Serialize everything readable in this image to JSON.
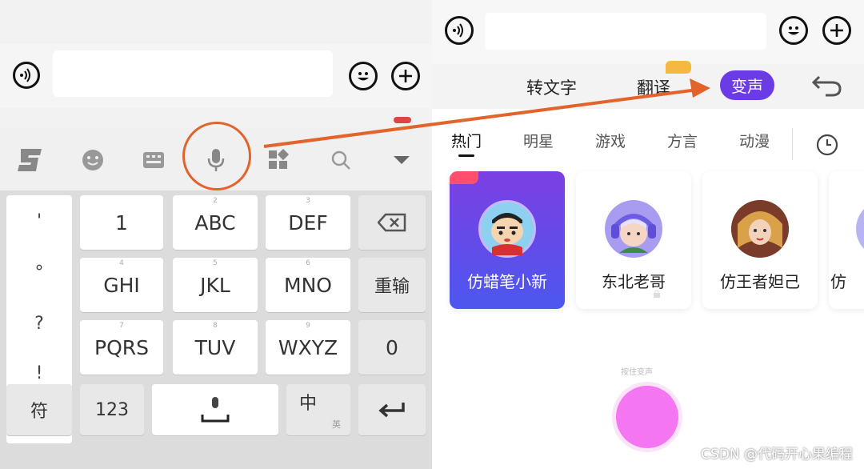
{
  "left": {
    "keyboard": {
      "punctuation": [
        "'",
        "°",
        "?",
        "!"
      ],
      "row1": [
        "1",
        "ABC",
        "DEF"
      ],
      "row1_mini": [
        "",
        "2",
        "3"
      ],
      "row2": [
        "GHI",
        "JKL",
        "MNO"
      ],
      "row2_mini": [
        "4",
        "5",
        "6"
      ],
      "row3": [
        "PQRS",
        "TUV",
        "WXYZ"
      ],
      "row3_mini": [
        "7",
        "8",
        "9"
      ],
      "reinput_label": "重输",
      "zero_label": "0",
      "symbol_label": "符",
      "num_label": "123",
      "cn_label": "中",
      "cn_sub_label": "英"
    }
  },
  "right": {
    "mode_tabs": {
      "speech_to_text": "转文字",
      "translate": "翻译",
      "voice_change": "变声"
    },
    "categories": [
      "热门",
      "明星",
      "游戏",
      "方言",
      "动漫"
    ],
    "cards": [
      {
        "name": "仿蜡笔小新"
      },
      {
        "name": "东北老哥"
      },
      {
        "name": "仿王者妲己"
      },
      {
        "name": "仿"
      }
    ],
    "press_hint": "按住变声",
    "watermark": "CSDN @代码开心果编程"
  },
  "colors": {
    "accent_purple": "#6a3be6",
    "highlight_orange": "#e2642a",
    "record_pink": "#f476f0"
  }
}
